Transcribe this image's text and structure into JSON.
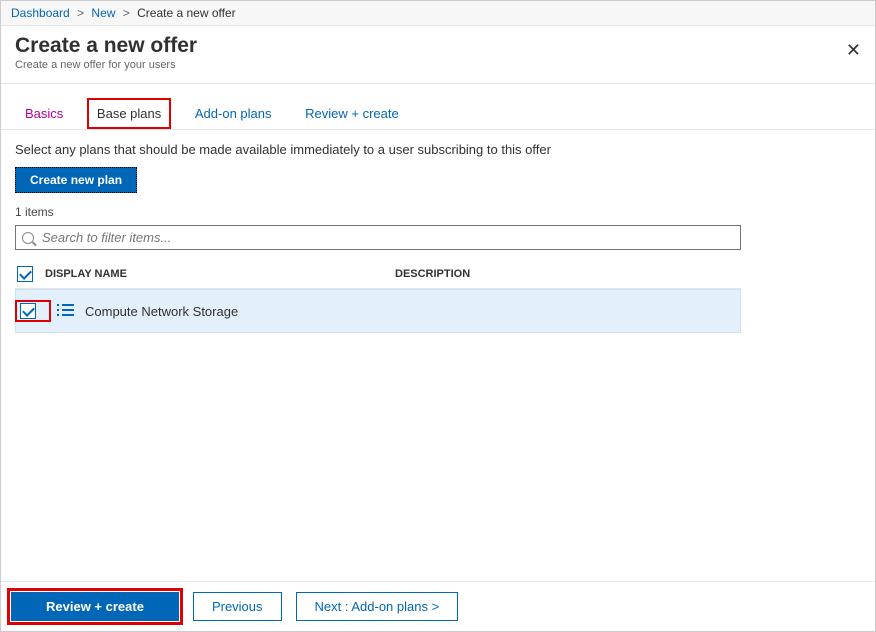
{
  "breadcrumb": {
    "dashboard": "Dashboard",
    "new": "New",
    "current": "Create a new offer"
  },
  "header": {
    "title": "Create a new offer",
    "subtitle": "Create a new offer for your users",
    "close_aria": "Close"
  },
  "tabs": {
    "basics": "Basics",
    "base_plans": "Base plans",
    "addon": "Add-on plans",
    "review": "Review + create"
  },
  "instruction": "Select any plans that should be made available immediately to a user subscribing to this offer",
  "create_plan_label": "Create new plan",
  "count_label": "1 items",
  "search": {
    "placeholder": "Search to filter items..."
  },
  "columns": {
    "name": "DISPLAY NAME",
    "desc": "DESCRIPTION"
  },
  "rows": [
    {
      "name": "Compute Network Storage",
      "desc": ""
    }
  ],
  "footer": {
    "review": "Review + create",
    "previous": "Previous",
    "next": "Next : Add-on plans  >"
  }
}
